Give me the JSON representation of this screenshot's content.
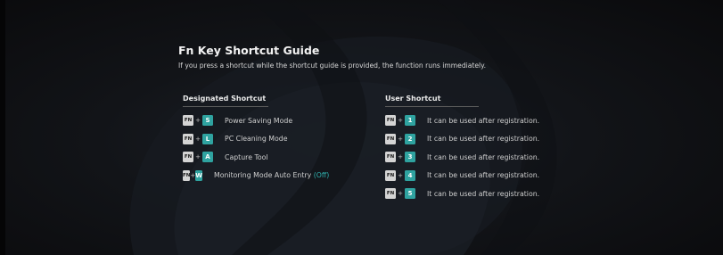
{
  "guide": {
    "title": "Fn Key Shortcut Guide",
    "subtitle": "If you press a shortcut while the shortcut guide is provided, the function runs immediately."
  },
  "designated": {
    "heading": "Designated Shortcut",
    "items": [
      {
        "fn": "FN",
        "plus": "+",
        "key": "S",
        "label": "Power Saving Mode",
        "status": ""
      },
      {
        "fn": "FN",
        "plus": "+",
        "key": "L",
        "label": "PC Cleaning Mode",
        "status": ""
      },
      {
        "fn": "FN",
        "plus": "+",
        "key": "A",
        "label": "Capture Tool",
        "status": ""
      },
      {
        "fn": "FN",
        "plus": "+",
        "key": "W",
        "label": "Monitoring Mode Auto Entry",
        "status": "(Off)"
      }
    ]
  },
  "user": {
    "heading": "User Shortcut",
    "items": [
      {
        "fn": "FN",
        "plus": "+",
        "key": "1",
        "label": "It can be used after registration."
      },
      {
        "fn": "FN",
        "plus": "+",
        "key": "2",
        "label": "It can be used after registration."
      },
      {
        "fn": "FN",
        "plus": "+",
        "key": "3",
        "label": "It can be used after registration."
      },
      {
        "fn": "FN",
        "plus": "+",
        "key": "4",
        "label": "It can be used after registration."
      },
      {
        "fn": "FN",
        "plus": "+",
        "key": "5",
        "label": "It can be used after registration."
      }
    ]
  },
  "colors": {
    "accent": "#2fa3a0",
    "fn_key": "#d4d4d4",
    "status": "#2fb3b0"
  }
}
